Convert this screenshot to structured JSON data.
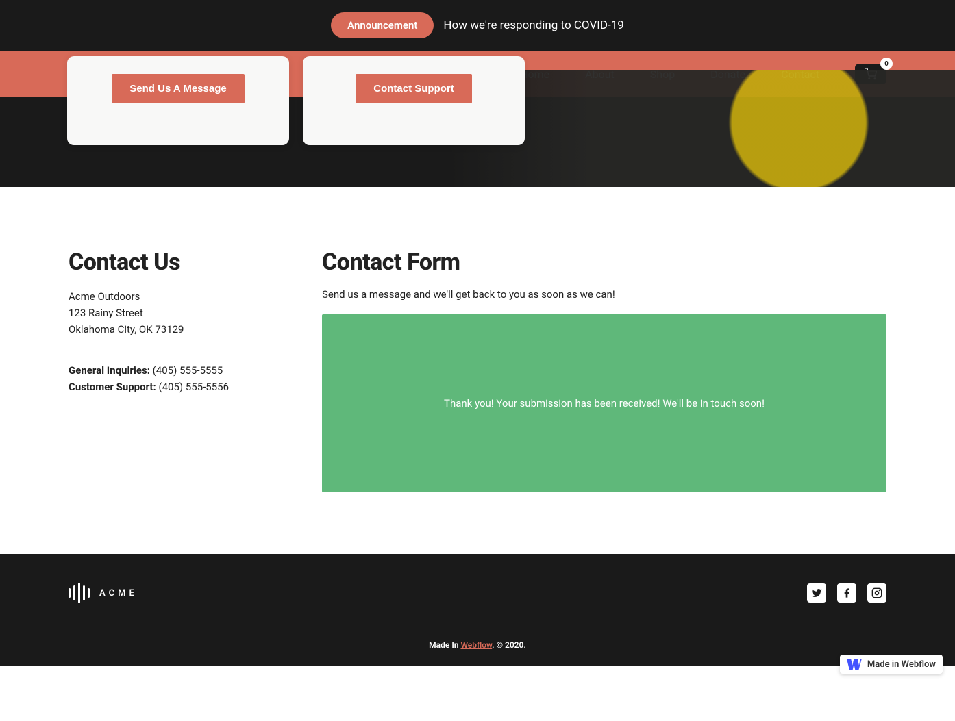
{
  "banner": {
    "pill": "Announcement",
    "text": "How we're responding to COVID-19"
  },
  "brand": {
    "name": "ACME"
  },
  "nav": {
    "items": [
      "Home",
      "About",
      "Shop",
      "Donate",
      "Contact"
    ],
    "cart_count": "0"
  },
  "cards": {
    "card1_btn": "Send Us A Message",
    "card2_btn": "Contact Support"
  },
  "contact": {
    "heading": "Contact Us",
    "company": "Acme Outdoors",
    "street": "123 Rainy Street",
    "city": "Oklahoma City, OK 73129",
    "general_label": "General Inquiries:",
    "general_phone": "(405) 555-5555",
    "support_label": "Customer Support:",
    "support_phone": "(405) 555-5556"
  },
  "form": {
    "heading": "Contact Form",
    "subtext": "Send us a message and we'll get back to you as soon as we can!",
    "success_msg": "Thank you! Your submission has been received! We'll be in touch soon!"
  },
  "footer": {
    "made_in": "Made In ",
    "webflow": "Webflow",
    "copyright": ". © 2020."
  },
  "badge": {
    "text": "Made in Webflow"
  }
}
